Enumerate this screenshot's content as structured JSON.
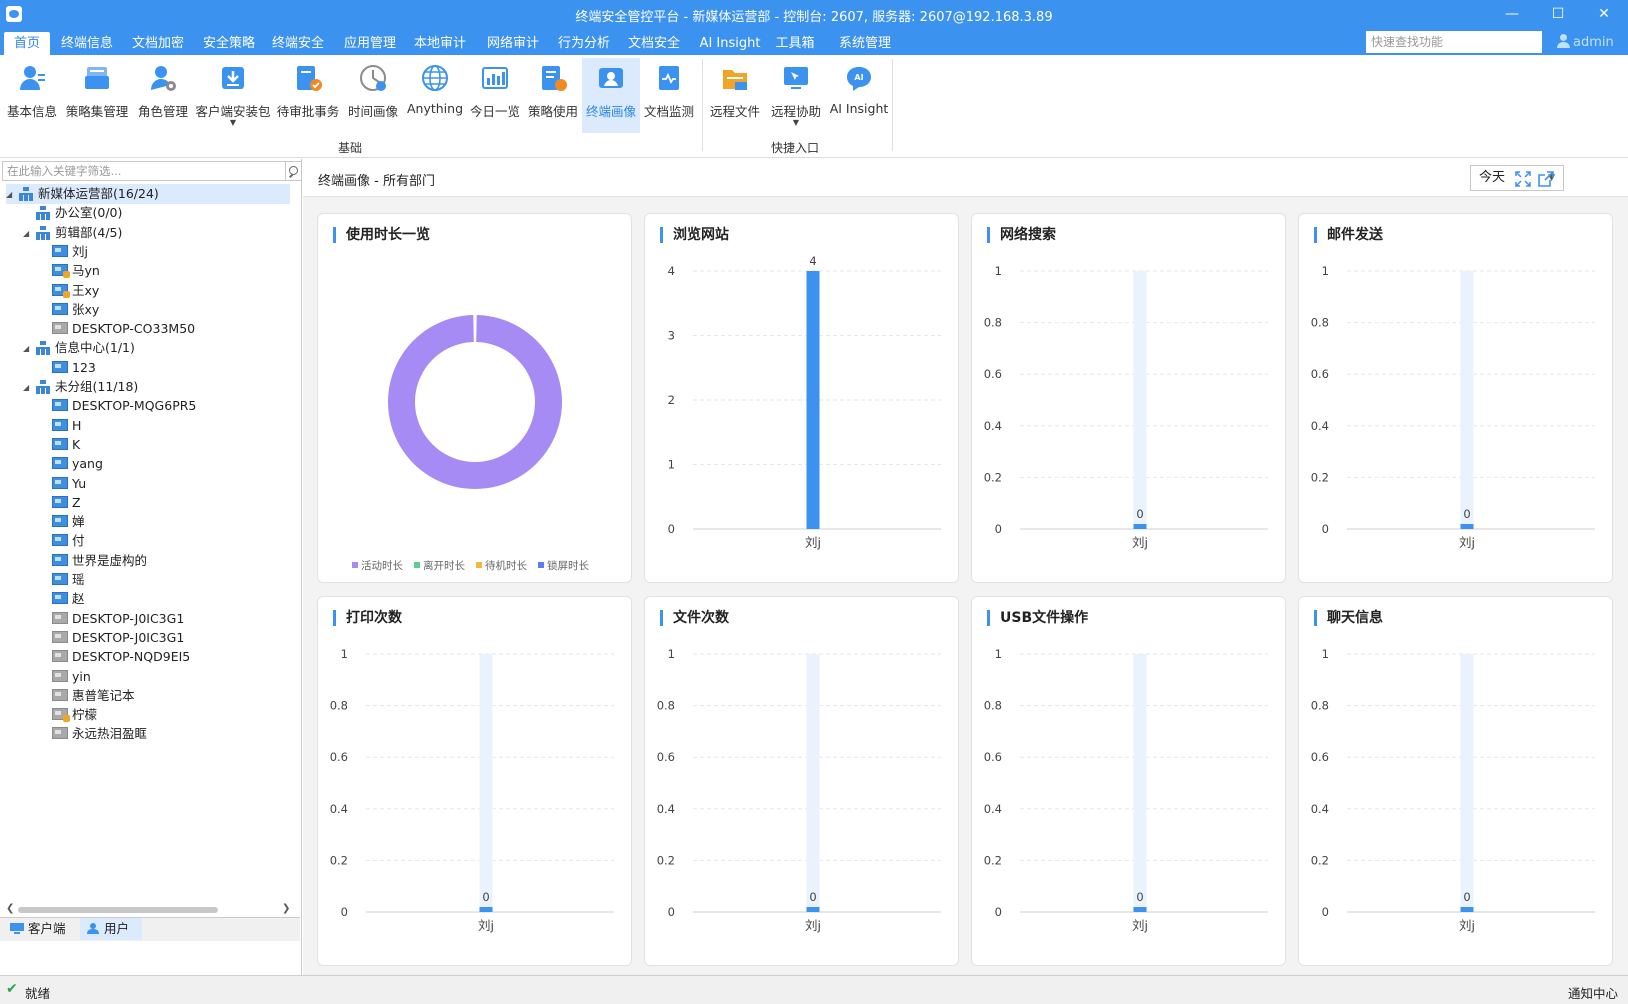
{
  "window": {
    "title": "终端安全管控平台 - 新媒体运营部 - 控制台: 2607, 服务器: 2607@192.168.3.89"
  },
  "menu": {
    "tabs": [
      "首页",
      "终端信息",
      "文档加密",
      "安全策略",
      "终端安全",
      "应用管理",
      "本地审计",
      "网络审计",
      "行为分析",
      "文档安全",
      "AI Insight",
      "工具箱",
      "系统管理"
    ],
    "active": "首页",
    "quick_search_placeholder": "快速查找功能",
    "user": "admin"
  },
  "ribbon": {
    "groups": [
      {
        "label": "基础",
        "buttons": [
          {
            "label": "基本信息",
            "icon": "user-info-icon"
          },
          {
            "label": "策略集管理",
            "icon": "policy-set-icon"
          },
          {
            "label": "角色管理",
            "icon": "role-icon"
          },
          {
            "label": "客户端安装包",
            "icon": "install-package-icon",
            "dropdown": true
          },
          {
            "label": "待审批事务",
            "icon": "approval-icon"
          },
          {
            "label": "时间画像",
            "icon": "clock-icon"
          },
          {
            "label": "Anything",
            "icon": "globe-icon"
          },
          {
            "label": "今日一览",
            "icon": "dashboard-icon"
          },
          {
            "label": "策略使用",
            "icon": "policy-usage-icon"
          },
          {
            "label": "终端画像",
            "icon": "terminal-portrait-icon",
            "active": true
          },
          {
            "label": "文档监测",
            "icon": "doc-monitor-icon"
          }
        ]
      },
      {
        "label": "快捷入口",
        "buttons": [
          {
            "label": "远程文件",
            "icon": "remote-file-icon"
          },
          {
            "label": "远程协助",
            "icon": "remote-assist-icon",
            "dropdown": true
          },
          {
            "label": "AI Insight",
            "icon": "ai-insight-icon"
          }
        ]
      }
    ]
  },
  "tree": {
    "filter_placeholder": "在此输入关键字筛选...",
    "nodes": [
      {
        "label": "新媒体运营部(16/24)",
        "type": "org",
        "level": 0,
        "expanded": true,
        "selected": true
      },
      {
        "label": "办公室(0/0)",
        "type": "org",
        "level": 1
      },
      {
        "label": "剪辑部(4/5)",
        "type": "org",
        "level": 1,
        "expanded": true
      },
      {
        "label": "刘j",
        "type": "pc",
        "level": 2
      },
      {
        "label": "马yn",
        "type": "pc-warn",
        "level": 2
      },
      {
        "label": "王xy",
        "type": "pc-warn",
        "level": 2
      },
      {
        "label": "张xy",
        "type": "pc",
        "level": 2
      },
      {
        "label": "DESKTOP-CO33M50",
        "type": "pc-off",
        "level": 2
      },
      {
        "label": "信息中心(1/1)",
        "type": "org",
        "level": 1,
        "expanded": true
      },
      {
        "label": "123",
        "type": "pc",
        "level": 2
      },
      {
        "label": "未分组(11/18)",
        "type": "org",
        "level": 1,
        "expanded": true
      },
      {
        "label": "DESKTOP-MQG6PR5",
        "type": "pc",
        "level": 2
      },
      {
        "label": "H",
        "type": "pc",
        "level": 2
      },
      {
        "label": "K",
        "type": "pc",
        "level": 2
      },
      {
        "label": "yang",
        "type": "pc",
        "level": 2
      },
      {
        "label": "Yu",
        "type": "pc",
        "level": 2
      },
      {
        "label": "Z",
        "type": "pc",
        "level": 2
      },
      {
        "label": "婵",
        "type": "pc",
        "level": 2
      },
      {
        "label": "付",
        "type": "pc",
        "level": 2
      },
      {
        "label": "世界是虚构的",
        "type": "pc",
        "level": 2
      },
      {
        "label": "瑶",
        "type": "pc",
        "level": 2
      },
      {
        "label": "赵",
        "type": "pc",
        "level": 2
      },
      {
        "label": "DESKTOP-J0IC3G1",
        "type": "pc-off",
        "level": 2
      },
      {
        "label": "DESKTOP-J0IC3G1",
        "type": "pc-off",
        "level": 2
      },
      {
        "label": "DESKTOP-NQD9EI5",
        "type": "pc-off",
        "level": 2
      },
      {
        "label": "yin",
        "type": "pc-off",
        "level": 2
      },
      {
        "label": "惠普笔记本",
        "type": "pc-off",
        "level": 2
      },
      {
        "label": "柠檬",
        "type": "pc-off-warn",
        "level": 2
      },
      {
        "label": "永远热泪盈眶",
        "type": "pc-off",
        "level": 2
      }
    ],
    "bottom_tabs": [
      {
        "label": "客户端",
        "icon": "client-icon"
      },
      {
        "label": "用户",
        "icon": "user-icon",
        "active": true
      }
    ]
  },
  "main": {
    "title": "终端画像 - 所有部门",
    "date_range": "今天",
    "fullscreen_icon": "fullscreen-icon",
    "export_icon": "export-icon"
  },
  "colors": {
    "accent": "#3c93ef",
    "bar": "#3c93ef",
    "bar_track": "#eaf3fd",
    "donut": "#a78bf5",
    "legend": [
      "#a78bf5",
      "#5ad08e",
      "#f6b73c",
      "#5a7ef0"
    ]
  },
  "chart_data": [
    {
      "type": "pie",
      "title": "使用时长一览",
      "series": [
        {
          "name": "活动时长",
          "value": 1
        },
        {
          "name": "离开时长",
          "value": 0
        },
        {
          "name": "待机时长",
          "value": 0
        },
        {
          "name": "锁屏时长",
          "value": 0
        }
      ],
      "legend_position": "bottom"
    },
    {
      "type": "bar",
      "title": "浏览网站",
      "categories": [
        "刘j"
      ],
      "values": [
        4
      ],
      "ylim": [
        0,
        4
      ],
      "yticks": [
        "0",
        "1",
        "2",
        "3",
        "4"
      ],
      "data_labels": [
        "4"
      ]
    },
    {
      "type": "bar",
      "title": "网络搜索",
      "categories": [
        "刘j"
      ],
      "values": [
        0
      ],
      "ylim": [
        0,
        1
      ],
      "yticks": [
        "0",
        "0.2",
        "0.4",
        "0.6",
        "0.8",
        "1"
      ],
      "data_labels": [
        "0"
      ]
    },
    {
      "type": "bar",
      "title": "邮件发送",
      "categories": [
        "刘j"
      ],
      "values": [
        0
      ],
      "ylim": [
        0,
        1
      ],
      "yticks": [
        "0",
        "0.2",
        "0.4",
        "0.6",
        "0.8",
        "1"
      ],
      "data_labels": [
        "0"
      ]
    },
    {
      "type": "bar",
      "title": "打印次数",
      "categories": [
        "刘j"
      ],
      "values": [
        0
      ],
      "ylim": [
        0,
        1
      ],
      "yticks": [
        "0",
        "0.2",
        "0.4",
        "0.6",
        "0.8",
        "1"
      ],
      "data_labels": [
        "0"
      ]
    },
    {
      "type": "bar",
      "title": "文件次数",
      "categories": [
        "刘j"
      ],
      "values": [
        0
      ],
      "ylim": [
        0,
        1
      ],
      "yticks": [
        "0",
        "0.2",
        "0.4",
        "0.6",
        "0.8",
        "1"
      ],
      "data_labels": [
        "0"
      ]
    },
    {
      "type": "bar",
      "title": "USB文件操作",
      "categories": [
        "刘j"
      ],
      "values": [
        0
      ],
      "ylim": [
        0,
        1
      ],
      "yticks": [
        "0",
        "0.2",
        "0.4",
        "0.6",
        "0.8",
        "1"
      ],
      "data_labels": [
        "0"
      ]
    },
    {
      "type": "bar",
      "title": "聊天信息",
      "categories": [
        "刘j"
      ],
      "values": [
        0
      ],
      "ylim": [
        0,
        1
      ],
      "yticks": [
        "0",
        "0.2",
        "0.4",
        "0.6",
        "0.8",
        "1"
      ],
      "data_labels": [
        "0"
      ]
    }
  ],
  "status": {
    "text": "就绪",
    "notify": "通知中心"
  }
}
